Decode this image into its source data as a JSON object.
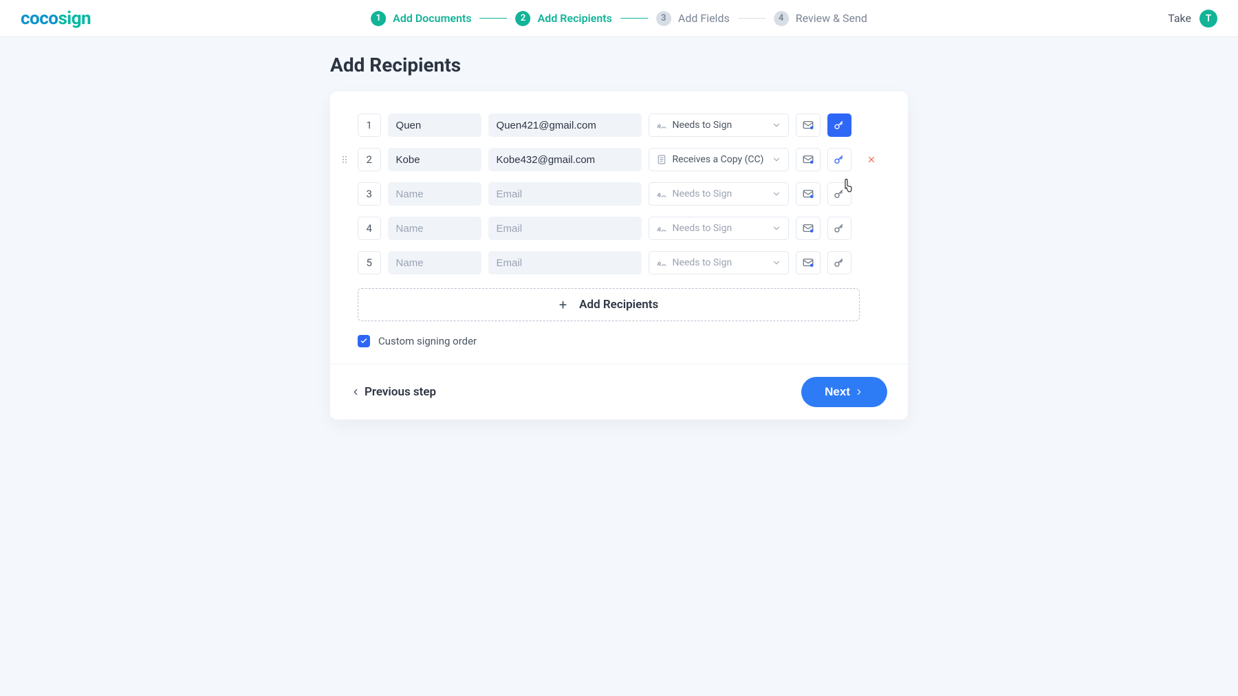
{
  "brand": {
    "part1": "coco",
    "part2": "sign"
  },
  "steps": [
    {
      "num": "1",
      "label": "Add Documents",
      "state": "done"
    },
    {
      "num": "2",
      "label": "Add Recipients",
      "state": "done"
    },
    {
      "num": "3",
      "label": "Add Fields",
      "state": "todo"
    },
    {
      "num": "4",
      "label": "Review & Send",
      "state": "todo"
    }
  ],
  "user": {
    "name": "Take",
    "initial": "T"
  },
  "page": {
    "title": "Add Recipients",
    "name_placeholder": "Name",
    "email_placeholder": "Email",
    "role_needs_to_sign": "Needs to Sign",
    "role_receives_copy": "Receives a Copy (CC)",
    "add_button": "Add Recipients",
    "custom_order_label": "Custom signing order",
    "prev_label": "Previous step",
    "next_label": "Next"
  },
  "recipients": [
    {
      "order": "1",
      "name": "Quen",
      "email": "Quen421@gmail.com",
      "role": "sign",
      "hover": false,
      "key_primary": true
    },
    {
      "order": "2",
      "name": "Kobe",
      "email": "Kobe432@gmail.com",
      "role": "cc",
      "hover": true,
      "key_primary": false
    },
    {
      "order": "3",
      "name": "",
      "email": "",
      "role": "empty",
      "hover": false,
      "key_primary": false
    },
    {
      "order": "4",
      "name": "",
      "email": "",
      "role": "empty",
      "hover": false,
      "key_primary": false
    },
    {
      "order": "5",
      "name": "",
      "email": "",
      "role": "empty",
      "hover": false,
      "key_primary": false
    }
  ]
}
